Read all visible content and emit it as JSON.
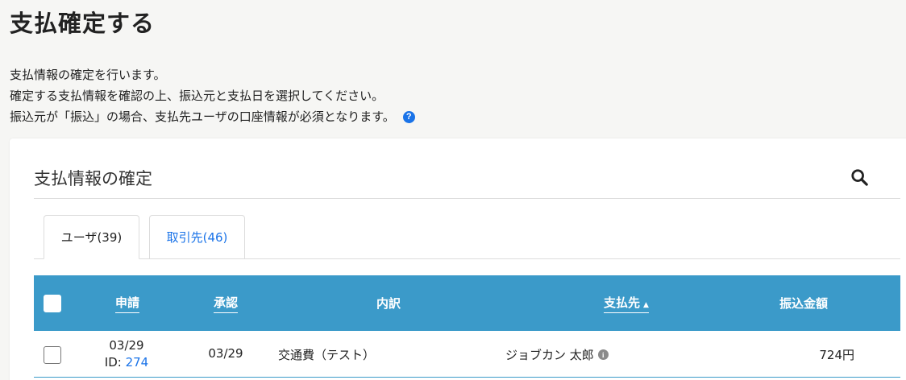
{
  "page": {
    "title": "支払確定する",
    "description": [
      "支払情報の確定を行います。",
      "確定する支払情報を確認の上、振込元と支払日を選択してください。",
      "振込元が「振込」の場合、支払先ユーザの口座情報が必須となります。"
    ],
    "help_icon": "question-circle-icon"
  },
  "card": {
    "title": "支払情報の確定",
    "search_icon": "search-icon"
  },
  "tabs": [
    {
      "label": "ユーザ(39)",
      "active": true
    },
    {
      "label": "取引先(46)",
      "active": false
    }
  ],
  "table": {
    "header_color": "#3b9ac9",
    "columns": {
      "applied": "申請",
      "approved": "承認",
      "detail": "内訳",
      "payee": "支払先",
      "amount": "振込金額"
    },
    "sort_indicator": "▲",
    "rows": [
      {
        "applied_date": "03/29",
        "id_label": "ID:",
        "id": "274",
        "approved_date": "03/29",
        "detail": "交通費（テスト）",
        "payee": "ジョブカン 太郎",
        "amount": "724円"
      }
    ]
  },
  "colors": {
    "accent": "#1a73e8",
    "header": "#3b9ac9"
  }
}
